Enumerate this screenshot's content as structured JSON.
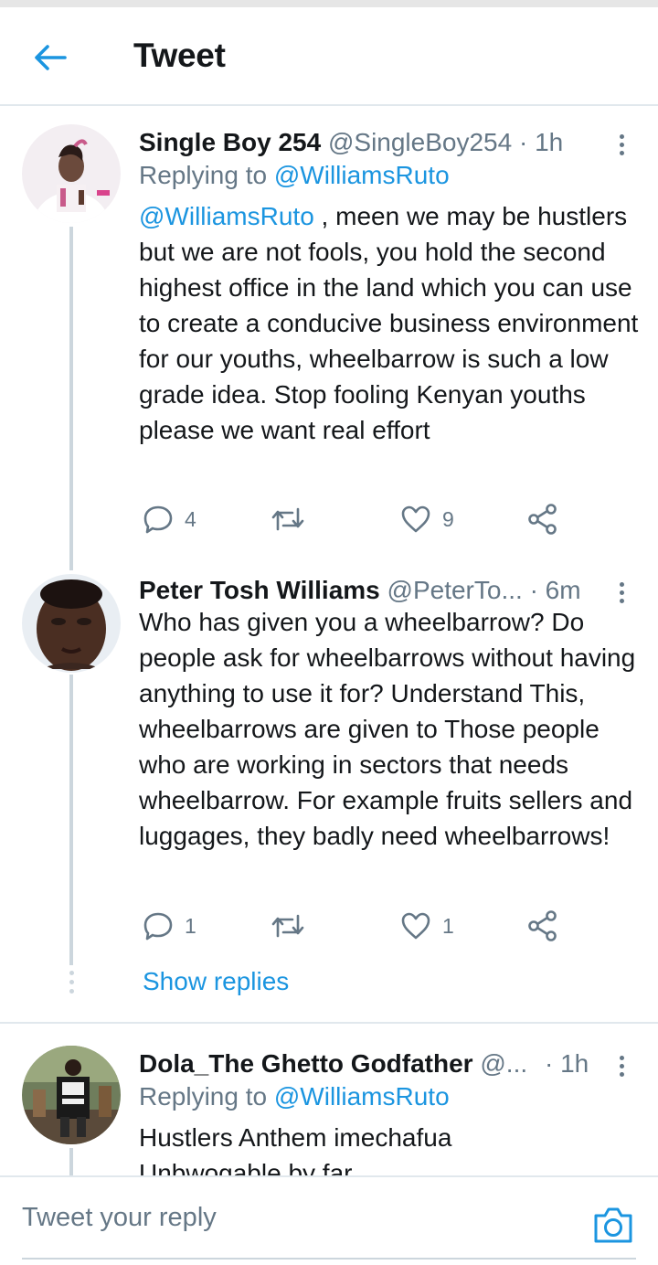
{
  "header": {
    "title": "Tweet",
    "back_icon": "back-arrow-icon",
    "accent_color": "#1b95e0"
  },
  "tweets": [
    {
      "name": "Single Boy 254",
      "handle": "@SingleBoy254",
      "time": "· 1h",
      "replying_prefix": "Replying to",
      "replying_to": "@WilliamsRuto",
      "mention": "@WilliamsRuto",
      "text": " , meen we may be hustlers but we are not fools,  you hold the second highest office in the land which you can use to create a conducive business environment for our youths, wheelbarrow is such a low grade idea. Stop fooling Kenyan youths please we want real effort",
      "replies": "4",
      "retweets": "",
      "likes": "9"
    },
    {
      "name": "Peter Tosh Williams",
      "handle": "@PeterTo...",
      "time": "· 6m",
      "text": "Who has given you a wheelbarrow? Do people ask for wheelbarrows without having anything to use it for? Understand This, wheelbarrows are given to Those people who are working in sectors that needs wheelbarrow. For example fruits sellers and luggages, they badly need wheelbarrows!",
      "replies": "1",
      "retweets": "",
      "likes": "1",
      "show_replies": "Show replies"
    },
    {
      "name": "Dola_The Ghetto Godfather",
      "handle": "@...",
      "time": "· 1h",
      "replying_prefix": "Replying to",
      "replying_to": "@WilliamsRuto",
      "text_line1": "Hustlers Anthem imechafua",
      "text_line2": "Unbwogable by far"
    }
  ],
  "reply_bar": {
    "placeholder": "Tweet your reply",
    "camera_icon": "camera-icon"
  }
}
